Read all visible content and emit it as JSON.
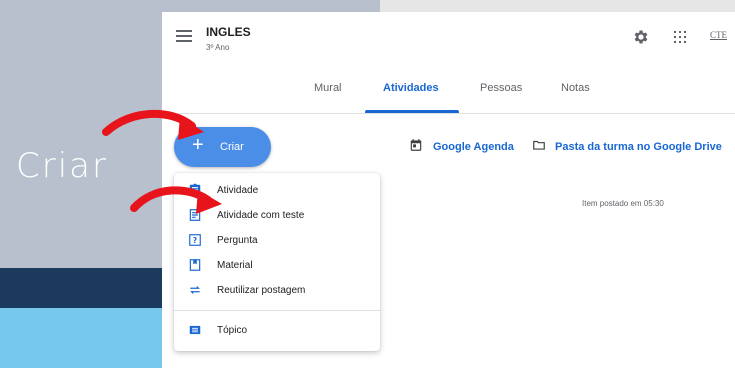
{
  "slide": {
    "caption": "Criar",
    "colors": {
      "gray": "#b7c0cc",
      "navy": "#1b3a5e",
      "light_blue": "#76c8ec",
      "arrow_red": "#e8141c"
    }
  },
  "header": {
    "title": "INGLES",
    "subtitle": "3º Ano",
    "account_label": "CTE",
    "icons": [
      "menu-icon",
      "gear-icon",
      "apps-icon"
    ]
  },
  "tabs": [
    {
      "label": "Mural",
      "active": false
    },
    {
      "label": "Atividades",
      "active": true
    },
    {
      "label": "Pessoas",
      "active": false
    },
    {
      "label": "Notas",
      "active": false
    }
  ],
  "toolbar": {
    "create_label": "Criar",
    "calendar_link": "Google Agenda",
    "drive_link": "Pasta da turma no Google Drive"
  },
  "posted_text": "Item postado em 05:30",
  "create_menu": {
    "items": [
      {
        "label": "Atividade",
        "icon": "assignment-icon"
      },
      {
        "label": "Atividade com teste",
        "icon": "quiz-icon"
      },
      {
        "label": "Pergunta",
        "icon": "question-icon"
      },
      {
        "label": "Material",
        "icon": "material-icon"
      },
      {
        "label": "Reutilizar postagem",
        "icon": "reuse-icon"
      },
      {
        "label": "Tópico",
        "icon": "topic-icon"
      }
    ]
  },
  "accent_color": "#1967d2"
}
